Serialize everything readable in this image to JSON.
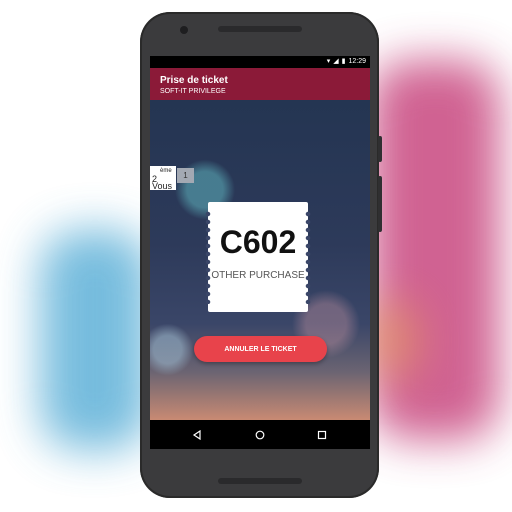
{
  "status": {
    "time": "12:29"
  },
  "app": {
    "title": "Prise de ticket",
    "subtitle": "SOFT-IT PRIVILEGE"
  },
  "queue": {
    "position": "2",
    "position_suffix": "ème",
    "position_label": "Vous",
    "count": "1"
  },
  "ticket": {
    "number": "C602",
    "service": "OTHER PURCHASE"
  },
  "actions": {
    "cancel_label": "ANNULER LE TICKET"
  },
  "colors": {
    "appbar": "#8b1a38",
    "cancel_button": "#e8434b"
  },
  "icons": [
    "wifi-icon",
    "signal-icon",
    "battery-icon",
    "back-icon",
    "home-icon",
    "recent-apps-icon"
  ]
}
